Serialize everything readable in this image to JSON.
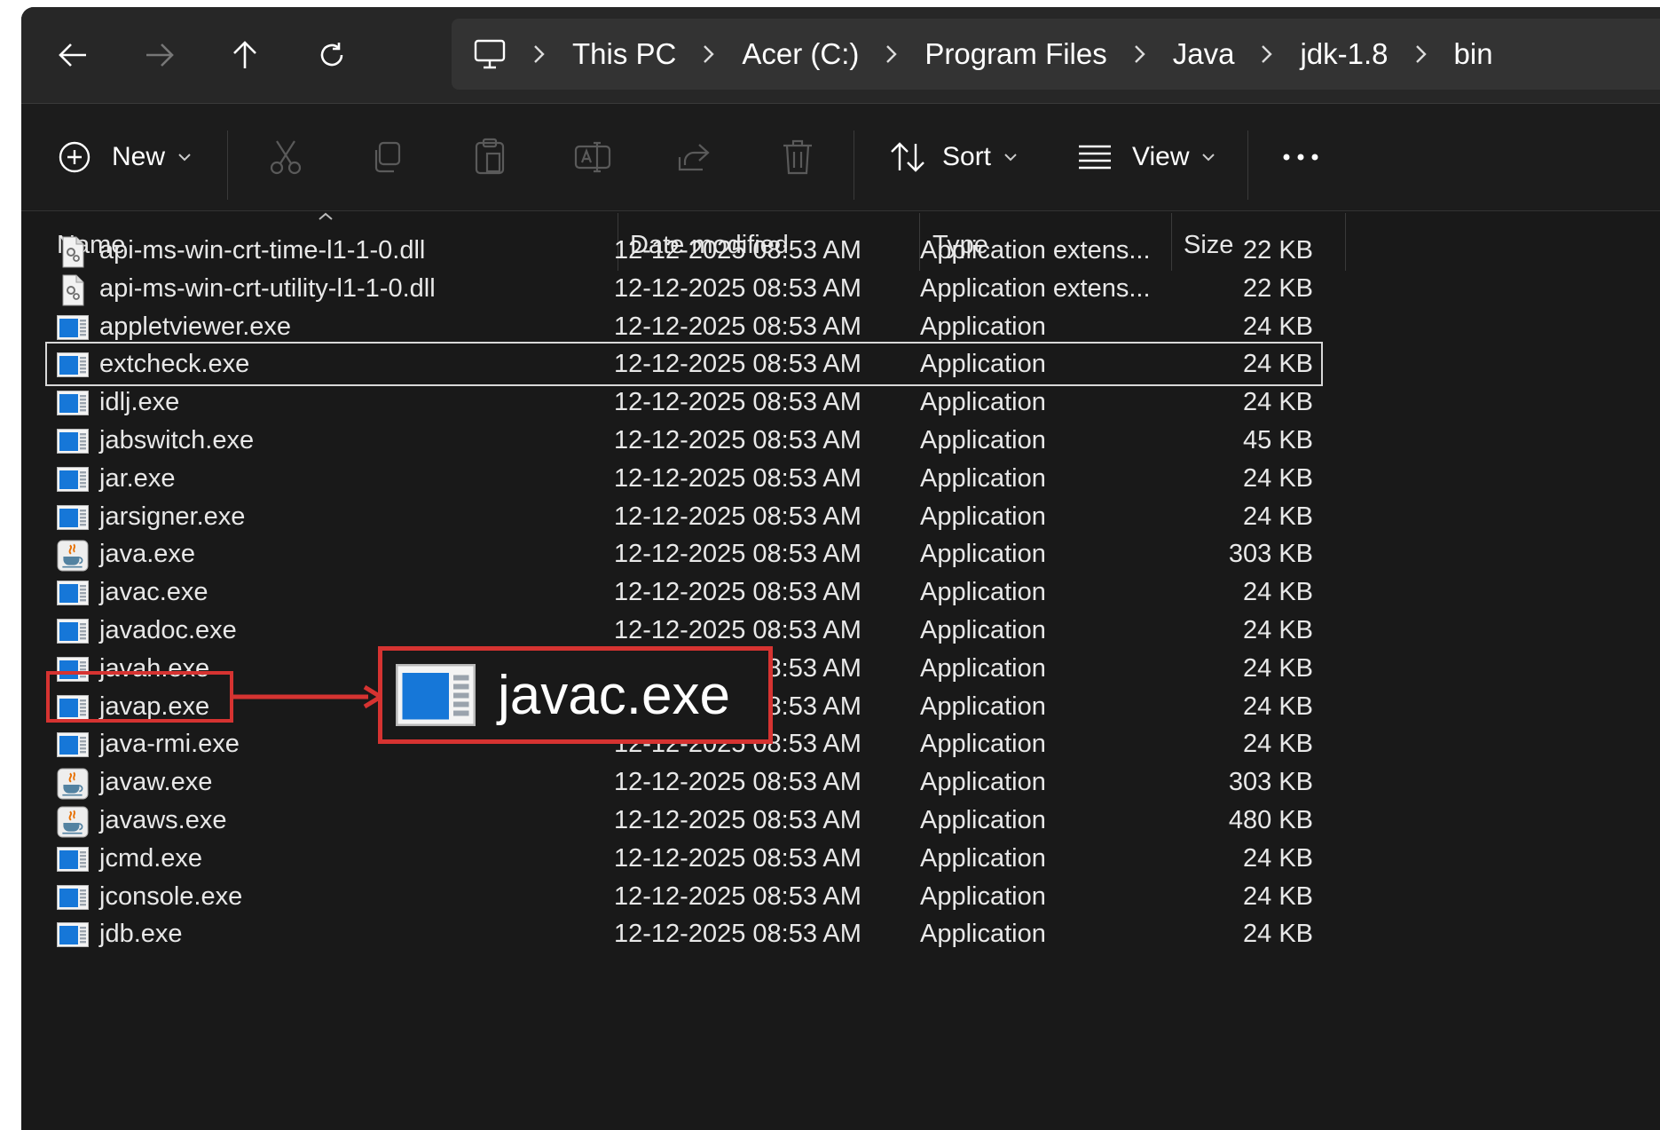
{
  "breadcrumb": [
    "This PC",
    "Acer (C:)",
    "Program Files",
    "Java",
    "jdk-1.8",
    "bin"
  ],
  "toolbar": {
    "new_label": "New",
    "sort_label": "Sort",
    "view_label": "View"
  },
  "columns": {
    "name": "Name",
    "date": "Date modified",
    "type": "Type",
    "size": "Size"
  },
  "files": [
    {
      "name": "api-ms-win-crt-time-l1-1-0.dll",
      "date": "12-12-2025 08:53 AM",
      "type": "Application extens...",
      "size": "22 KB",
      "icon": "dll-file-icon"
    },
    {
      "name": "api-ms-win-crt-utility-l1-1-0.dll",
      "date": "12-12-2025 08:53 AM",
      "type": "Application extens...",
      "size": "22 KB",
      "icon": "dll-file-icon"
    },
    {
      "name": "appletviewer.exe",
      "date": "12-12-2025 08:53 AM",
      "type": "Application",
      "size": "24 KB",
      "icon": "exe-app-icon"
    },
    {
      "name": "extcheck.exe",
      "date": "12-12-2025 08:53 AM",
      "type": "Application",
      "size": "24 KB",
      "icon": "exe-app-icon",
      "selected": true
    },
    {
      "name": "idlj.exe",
      "date": "12-12-2025 08:53 AM",
      "type": "Application",
      "size": "24 KB",
      "icon": "exe-app-icon"
    },
    {
      "name": "jabswitch.exe",
      "date": "12-12-2025 08:53 AM",
      "type": "Application",
      "size": "45 KB",
      "icon": "exe-app-icon"
    },
    {
      "name": "jar.exe",
      "date": "12-12-2025 08:53 AM",
      "type": "Application",
      "size": "24 KB",
      "icon": "exe-app-icon"
    },
    {
      "name": "jarsigner.exe",
      "date": "12-12-2025 08:53 AM",
      "type": "Application",
      "size": "24 KB",
      "icon": "exe-app-icon"
    },
    {
      "name": "java.exe",
      "date": "12-12-2025 08:53 AM",
      "type": "Application",
      "size": "303 KB",
      "icon": "java-cup-icon"
    },
    {
      "name": "javac.exe",
      "date": "12-12-2025 08:53 AM",
      "type": "Application",
      "size": "24 KB",
      "icon": "exe-app-icon"
    },
    {
      "name": "javadoc.exe",
      "date": "12-12-2025 08:53 AM",
      "type": "Application",
      "size": "24 KB",
      "icon": "exe-app-icon"
    },
    {
      "name": "javah.exe",
      "date": "12-12-2025 08:53 AM",
      "type": "Application",
      "size": "24 KB",
      "icon": "exe-app-icon"
    },
    {
      "name": "javap.exe",
      "date": "12-12-2025 08:53 AM",
      "type": "Application",
      "size": "24 KB",
      "icon": "exe-app-icon"
    },
    {
      "name": "java-rmi.exe",
      "date": "12-12-2025 08:53 AM",
      "type": "Application",
      "size": "24 KB",
      "icon": "exe-app-icon"
    },
    {
      "name": "javaw.exe",
      "date": "12-12-2025 08:53 AM",
      "type": "Application",
      "size": "303 KB",
      "icon": "java-cup-icon"
    },
    {
      "name": "javaws.exe",
      "date": "12-12-2025 08:53 AM",
      "type": "Application",
      "size": "480 KB",
      "icon": "java-cup-icon"
    },
    {
      "name": "jcmd.exe",
      "date": "12-12-2025 08:53 AM",
      "type": "Application",
      "size": "24 KB",
      "icon": "exe-app-icon"
    },
    {
      "name": "jconsole.exe",
      "date": "12-12-2025 08:53 AM",
      "type": "Application",
      "size": "24 KB",
      "icon": "exe-app-icon"
    },
    {
      "name": "jdb.exe",
      "date": "12-12-2025 08:53 AM",
      "type": "Application",
      "size": "24 KB",
      "icon": "exe-app-icon"
    }
  ],
  "callout": {
    "label": "javac.exe",
    "icon": "exe-app-icon",
    "color": "#d63331"
  },
  "colors": {
    "background": "#191919",
    "accent": "#d63331",
    "text": "#e8e8e8"
  }
}
